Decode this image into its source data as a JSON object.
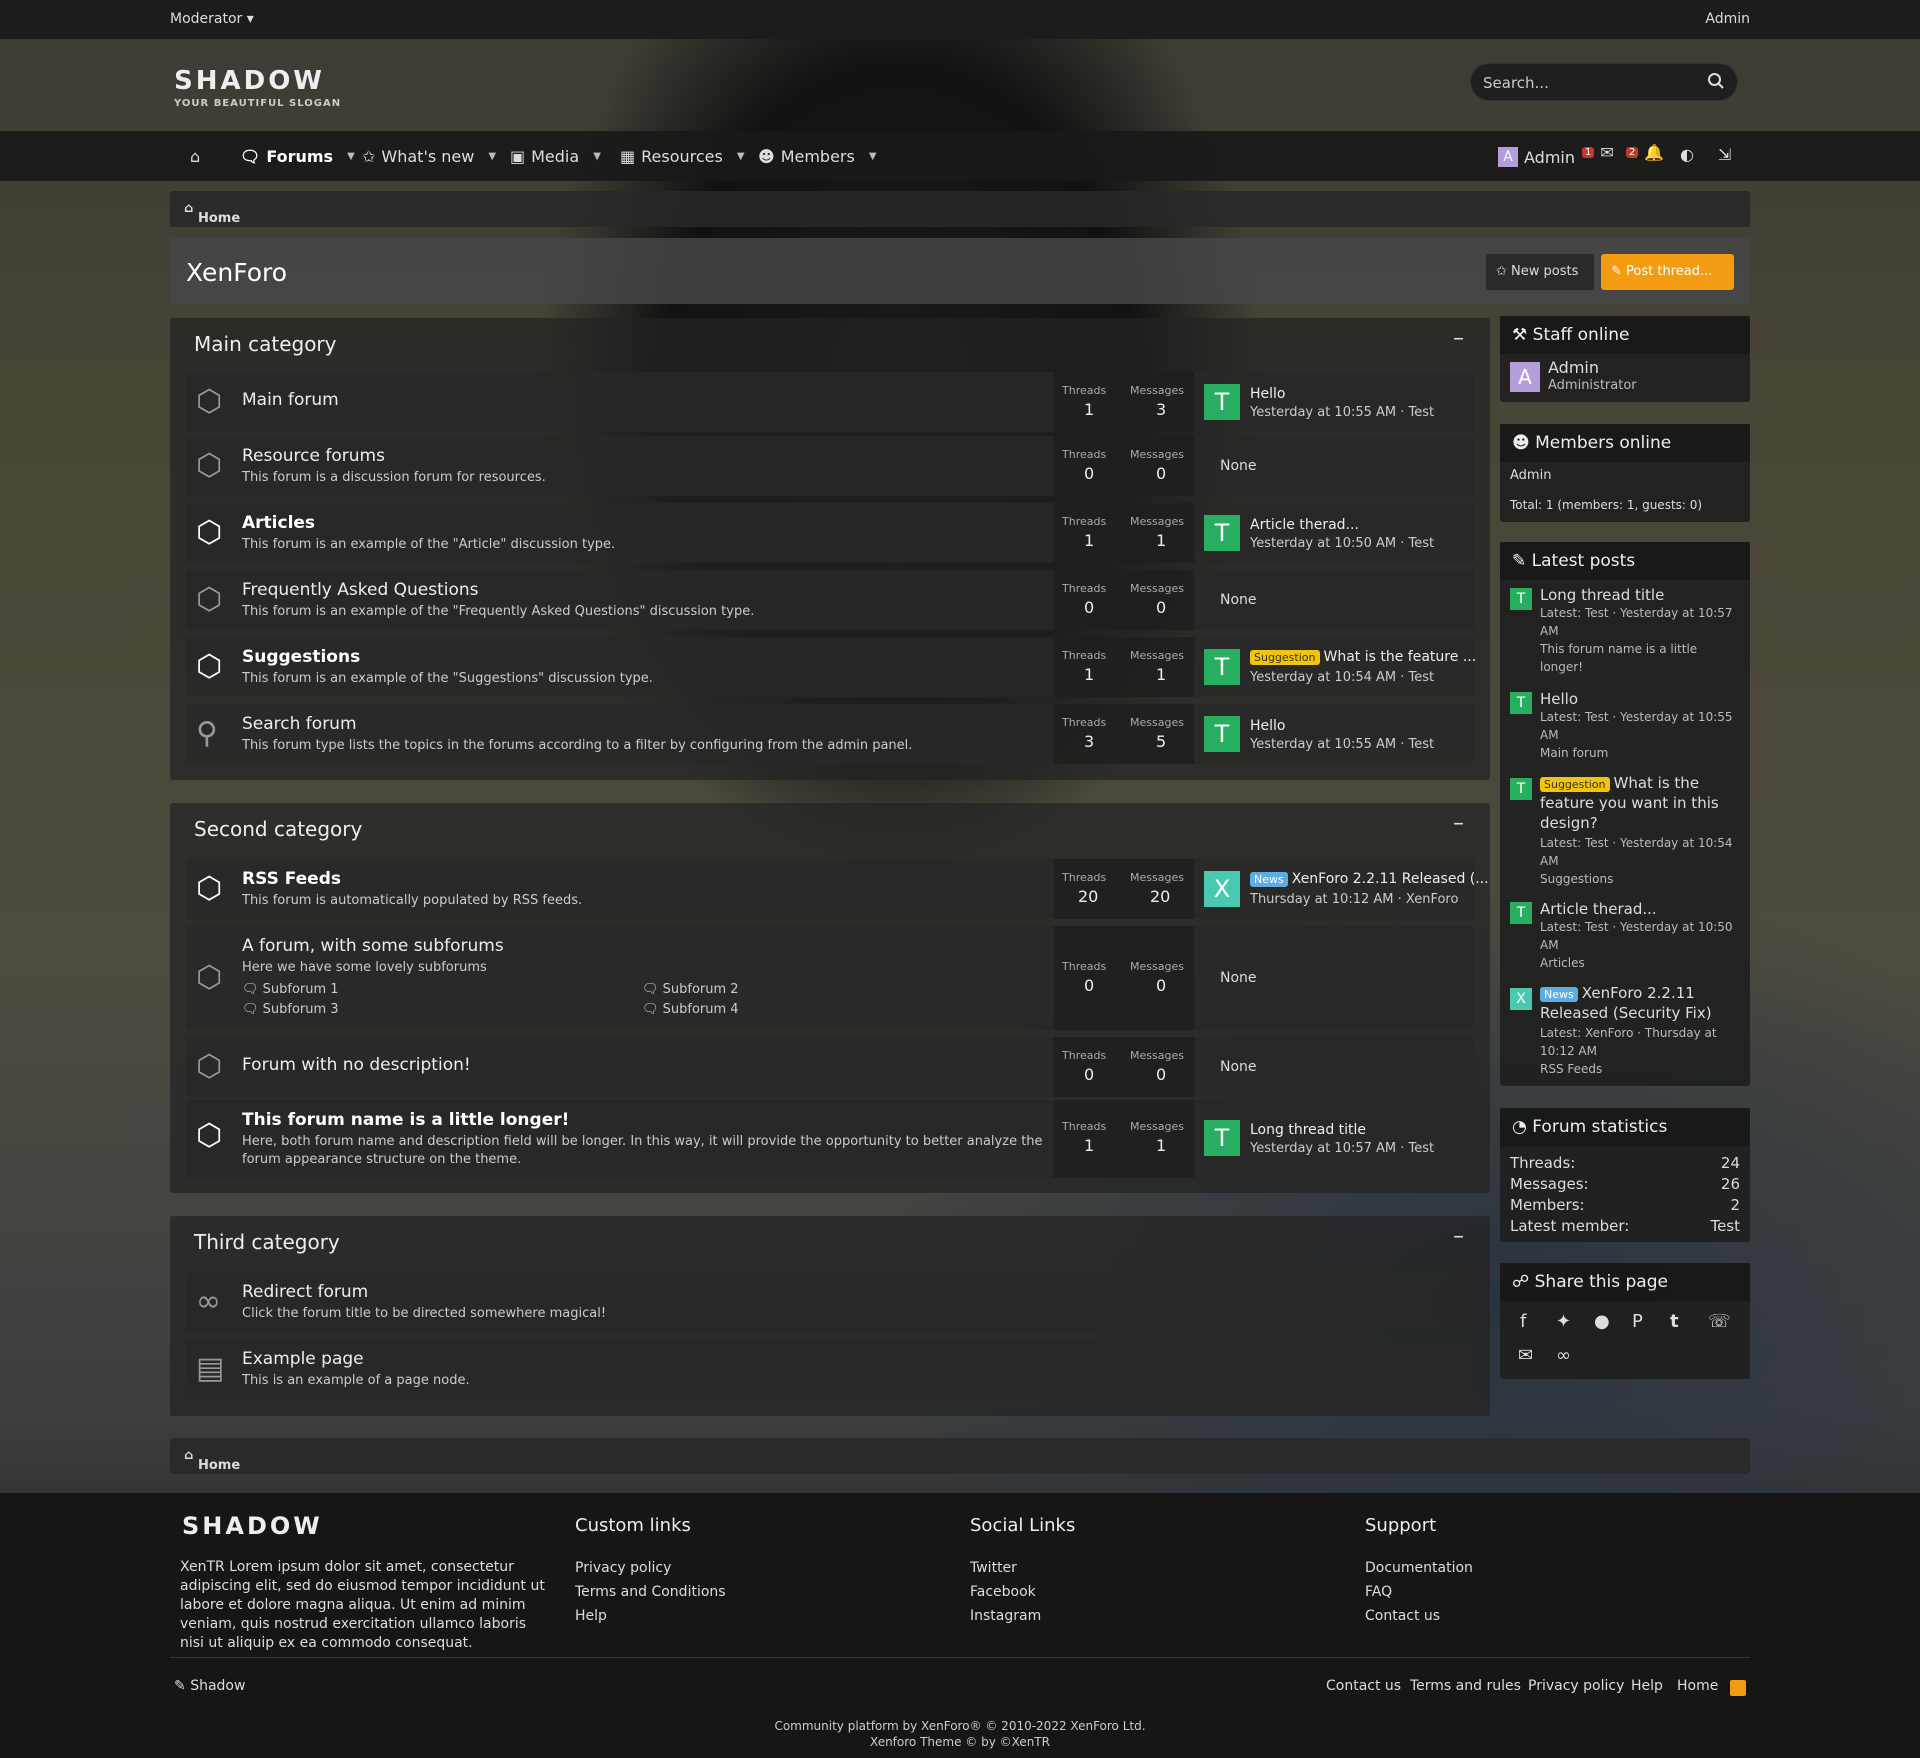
{
  "topbar": {
    "left": "Moderator ▾",
    "right": "Admin"
  },
  "logo": {
    "name": "SHADOW",
    "slogan": "YOUR BEAUTIFUL SLOGAN"
  },
  "search": {
    "placeholder": "Search..."
  },
  "nav": {
    "forums": "Forums",
    "whats_new": "What's new",
    "media": "Media",
    "resources": "Resources",
    "members": "Members",
    "user": "Admin",
    "badge1": "1",
    "badge2": "2"
  },
  "breadcrumb": {
    "home": "Home"
  },
  "page": {
    "title": "XenForo",
    "new_posts": "New posts",
    "post_thread": "Post thread..."
  },
  "labels": {
    "threads": "Threads",
    "messages": "Messages",
    "none": "None"
  },
  "categories": [
    {
      "title": "Main category",
      "nodes": [
        {
          "title": "Main forum",
          "desc": "",
          "threads": "1",
          "messages": "3",
          "last_title": "Hello",
          "last_meta": "Yesterday at 10:55 AM · Test",
          "avatar": "T"
        },
        {
          "title": "Resource forums",
          "desc": "This forum is a discussion forum for resources.",
          "threads": "0",
          "messages": "0"
        },
        {
          "title": "Articles",
          "desc": "This forum is an example of the \"Article\" discussion type.",
          "threads": "1",
          "messages": "1",
          "last_title": "Article therad...",
          "last_meta": "Yesterday at 10:50 AM · Test",
          "avatar": "T"
        },
        {
          "title": "Frequently Asked Questions",
          "desc": "This forum is an example of the \"Frequently Asked Questions\" discussion type.",
          "threads": "0",
          "messages": "0"
        },
        {
          "title": "Suggestions",
          "desc": "This forum is an example of the \"Suggestions\" discussion type.",
          "threads": "1",
          "messages": "1",
          "prefix": "Suggestion",
          "last_title": "What is the feature ...",
          "last_meta": "Yesterday at 10:54 AM · Test",
          "avatar": "T"
        },
        {
          "title": "Search forum",
          "desc": "This forum type lists the topics in the forums according to a filter by configuring from the admin panel.",
          "threads": "3",
          "messages": "5",
          "last_title": "Hello",
          "last_meta": "Yesterday at 10:55 AM · Test",
          "avatar": "T"
        }
      ]
    },
    {
      "title": "Second category",
      "nodes": [
        {
          "title": "RSS Feeds",
          "desc": "This forum is automatically populated by RSS feeds.",
          "threads": "20",
          "messages": "20",
          "prefix": "News",
          "last_title": "XenForo 2.2.11 Released (...",
          "last_meta": "Thursday at 10:12 AM · XenForo",
          "avatar": "X"
        },
        {
          "title": "A forum, with some subforums",
          "desc": "Here we have some lovely subforums",
          "threads": "0",
          "messages": "0",
          "subforums": [
            "Subforum 1",
            "Subforum 2",
            "Subforum 3",
            "Subforum 4"
          ]
        },
        {
          "title": "Forum with no description!",
          "desc": "",
          "threads": "0",
          "messages": "0"
        },
        {
          "title": "This forum name is a little longer!",
          "desc": "Here, both forum name and description field will be longer. In this way, it will provide the opportunity to better analyze the",
          "desc2": "forum appearance structure on the theme.",
          "threads": "1",
          "messages": "1",
          "last_title": "Long thread title",
          "last_meta": "Yesterday at 10:57 AM · Test",
          "avatar": "T"
        }
      ]
    },
    {
      "title": "Third category",
      "nodes": [
        {
          "title": "Redirect forum",
          "desc": "Click the forum title to be directed somewhere magical!"
        },
        {
          "title": "Example page",
          "desc": "This is an example of a page node."
        }
      ]
    }
  ],
  "sidebar": {
    "staff": {
      "title": "Staff online",
      "name": "Admin",
      "role": "Administrator",
      "avatar": "A"
    },
    "members": {
      "title": "Members online",
      "name": "Admin",
      "total": "Total: 1 (members: 1, guests: 0)"
    },
    "latest": {
      "title": "Latest posts",
      "items": [
        {
          "l1": "Long thread title",
          "l2": "Latest: Test · Yesterday at 10:57",
          "l3": "AM",
          "l4": "This forum name is a little",
          "l5": "longer!",
          "av": "T"
        },
        {
          "l1": "Hello",
          "l2": "Latest: Test · Yesterday at 10:55",
          "l3": "AM",
          "l4": "Main forum",
          "av": "T"
        },
        {
          "prefix": "Suggestion",
          "l1": "What is the",
          "l1b": "feature you want in this",
          "l1c": "design?",
          "l2": "Latest: Test · Yesterday at 10:54",
          "l3": "AM",
          "l4": "Suggestions",
          "av": "T"
        },
        {
          "l1": "Article therad...",
          "l2": "Latest: Test · Yesterday at 10:50",
          "l3": "AM",
          "l4": "Articles",
          "av": "T"
        },
        {
          "prefix": "News",
          "l1": "XenForo 2.2.11",
          "l1b": "Released (Security Fix)",
          "l2": "Latest: XenForo · Thursday at",
          "l3": "10:12 AM",
          "l4": "RSS Feeds",
          "av": "X"
        }
      ]
    },
    "stats": {
      "title": "Forum statistics",
      "rows": [
        [
          "Threads:",
          "24"
        ],
        [
          "Messages:",
          "26"
        ],
        [
          "Members:",
          "2"
        ],
        [
          "Latest member:",
          "Test"
        ]
      ]
    },
    "share": {
      "title": "Share this page"
    }
  },
  "footer": {
    "logo": "SHADOW",
    "text": "XenTR Lorem ipsum dolor sit amet, consectetur adipiscing elit, sed do eiusmod tempor incididunt ut labore et dolore magna aliqua. Ut enim ad minim veniam, quis nostrud exercitation ullamco laboris nisi ut aliquip ex ea commodo consequat.",
    "cols": [
      {
        "title": "Custom links",
        "links": [
          "Privacy policy",
          "Terms and Conditions",
          "Help"
        ]
      },
      {
        "title": "Social Links",
        "links": [
          "Twitter",
          "Facebook",
          "Instagram"
        ]
      },
      {
        "title": "Support",
        "links": [
          "Documentation",
          "FAQ",
          "Contact us"
        ]
      }
    ],
    "style": "Shadow",
    "bottom": [
      "Contact us",
      "Terms and rules",
      "Privacy policy",
      "Help",
      "Home"
    ],
    "copy1": "Community platform by XenForo® © 2010-2022 XenForo Ltd.",
    "copy2": "Xenforo Theme © by ©XenTR"
  },
  "colors": {
    "accent": "#f39c12",
    "avatar_t": "#27ae60",
    "avatar_a": "#b39ddb",
    "avatar_x": "#48c9b0"
  }
}
